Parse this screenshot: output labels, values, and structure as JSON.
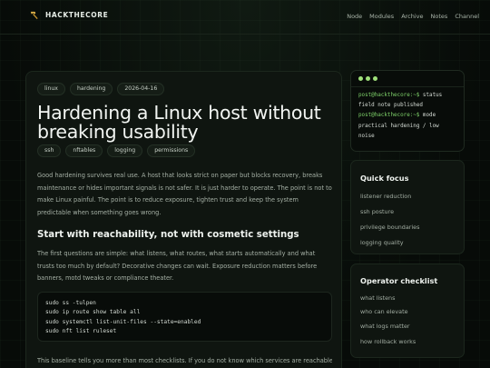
{
  "brand": {
    "name": "HACKTHECORE",
    "logo_icon": "hammer-icon"
  },
  "nav": [
    "Node",
    "Modules",
    "Archive",
    "Notes",
    "Channel"
  ],
  "article": {
    "tags": [
      "linux",
      "hardening",
      "2026-04-16"
    ],
    "title": "Hardening a Linux host without breaking usability",
    "subtags": [
      "ssh",
      "nftables",
      "logging",
      "permissions"
    ],
    "lead": "Good hardening survives real use. A host that looks strict on paper but blocks recovery, breaks maintenance or hides important signals is not safer. It is just harder to operate. The point is not to make Linux painful. The point is to reduce exposure, tighten trust and keep the system predictable when something goes wrong.",
    "section_heading": "Start with reachability, not with cosmetic settings",
    "section_body": "The first questions are simple: what listens, what routes, what starts automatically and what trusts too much by default? Decorative changes can wait. Exposure reduction matters before banners, motd tweaks or compliance theater.",
    "code": [
      "sudo ss -tulpen",
      "sudo ip route show table all",
      "sudo systemctl list-unit-files --state=enabled",
      "sudo nft list ruleset"
    ],
    "after_code": "This baseline tells you more than most checklists. If you do not know which services are reachable"
  },
  "terminal": {
    "lines": [
      {
        "prompt": "post@hackthecore:~$",
        "cmd": " status"
      },
      {
        "prompt": "",
        "cmd": "field note published"
      },
      {
        "prompt": "post@hackthecore:~$",
        "cmd": " mode"
      },
      {
        "prompt": "",
        "cmd": "practical hardening / low"
      },
      {
        "prompt": "",
        "cmd": "noise"
      }
    ]
  },
  "quick_focus": {
    "title": "Quick focus",
    "items": [
      "listener reduction",
      "ssh posture",
      "privilege boundaries",
      "logging quality"
    ]
  },
  "checklist": {
    "title": "Operator checklist",
    "items": [
      "what listens",
      "who can elevate",
      "what logs matter",
      "how rollback works"
    ]
  },
  "colors": {
    "accent": "#7fd36a",
    "background": "#070b08",
    "card": "#0f1510"
  }
}
